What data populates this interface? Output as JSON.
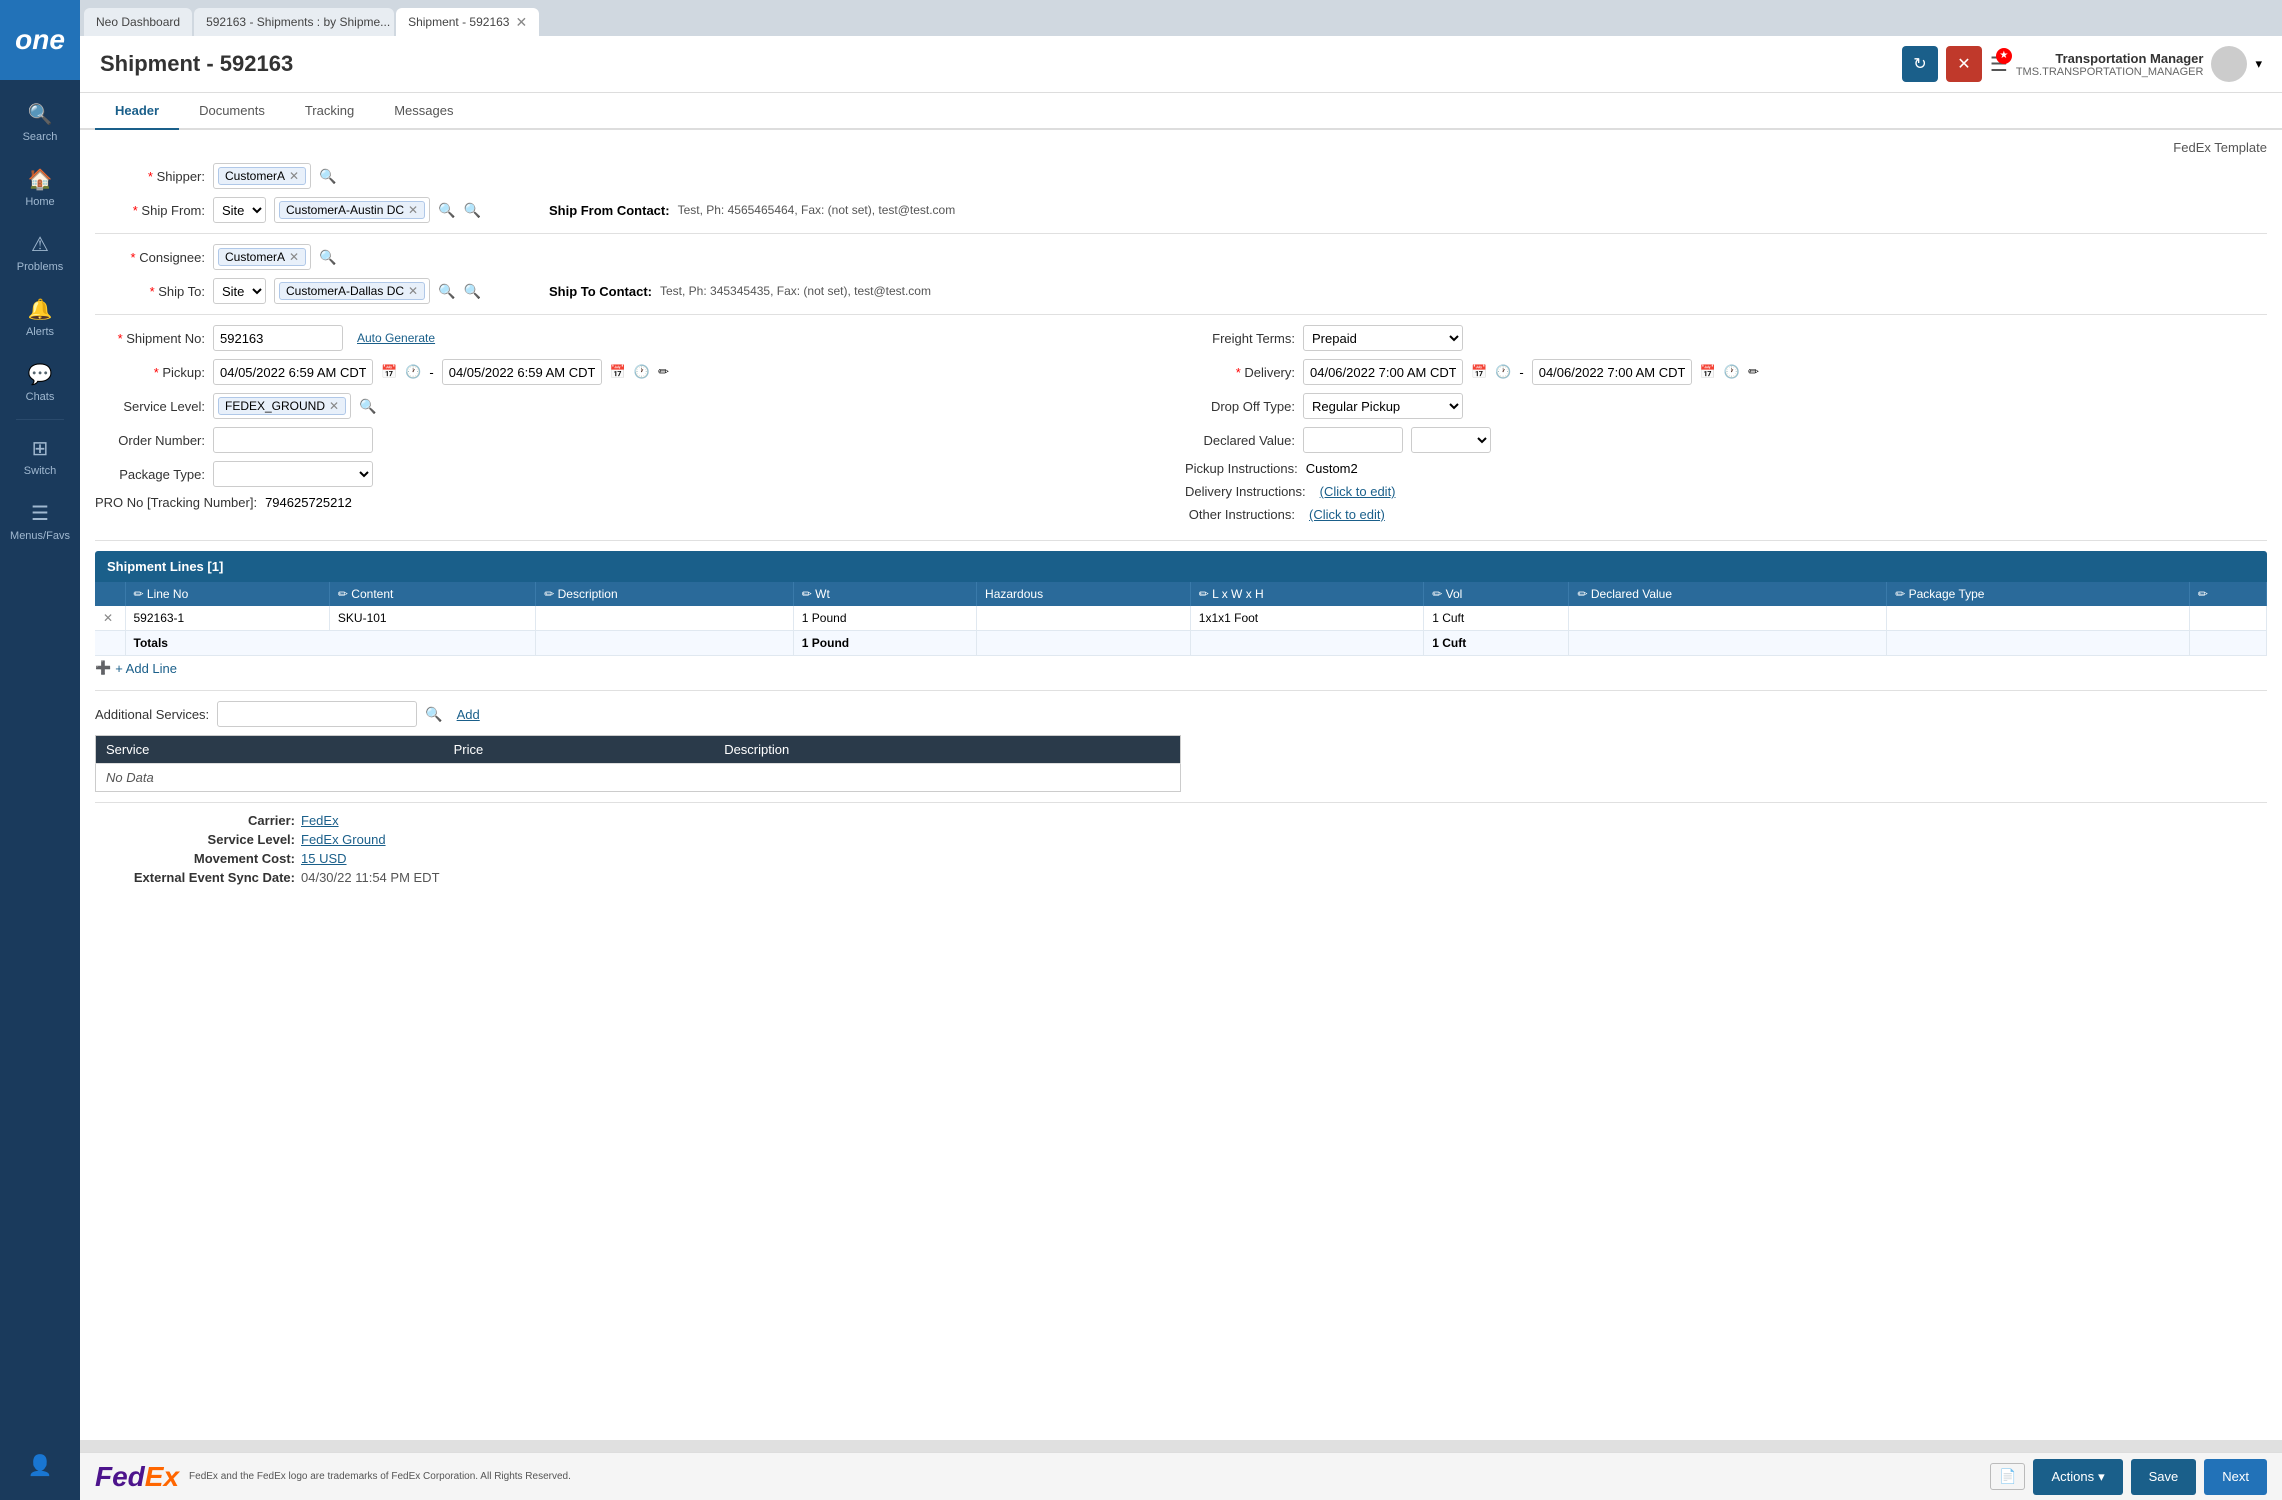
{
  "app": {
    "logo": "one",
    "title": "Shipment - 592163"
  },
  "sidebar": {
    "items": [
      {
        "label": "Search",
        "icon": "🔍"
      },
      {
        "label": "Home",
        "icon": "🏠"
      },
      {
        "label": "Problems",
        "icon": "⚠"
      },
      {
        "label": "Alerts",
        "icon": "🔔"
      },
      {
        "label": "Chats",
        "icon": "💬"
      },
      {
        "label": "Switch",
        "icon": "⊞"
      },
      {
        "label": "Menus/Favs",
        "icon": "☰"
      }
    ]
  },
  "browser_tabs": [
    {
      "label": "Neo Dashboard",
      "active": false,
      "closeable": false
    },
    {
      "label": "592163 - Shipments : by Shipme...",
      "active": false,
      "closeable": true
    },
    {
      "label": "Shipment - 592163",
      "active": true,
      "closeable": true
    }
  ],
  "header": {
    "title": "Shipment - 592163",
    "user_name": "Transportation Manager",
    "user_role": "TMS.TRANSPORTATION_MANAGER"
  },
  "tabs": [
    {
      "label": "Header",
      "active": true
    },
    {
      "label": "Documents",
      "active": false
    },
    {
      "label": "Tracking",
      "active": false
    },
    {
      "label": "Messages",
      "active": false
    }
  ],
  "fedex_template": "FedEx Template",
  "form": {
    "shipper_label": "Shipper:",
    "shipper_value": "CustomerA",
    "ship_from_label": "Ship From:",
    "ship_from_site": "Site",
    "ship_from_dc": "CustomerA-Austin DC",
    "ship_from_contact_label": "Ship From Contact:",
    "ship_from_contact_value": "Test, Ph: 4565465464, Fax: (not set), test@test.com",
    "consignee_label": "Consignee:",
    "consignee_value": "CustomerA",
    "ship_to_label": "Ship To:",
    "ship_to_site": "Site",
    "ship_to_dc": "CustomerA-Dallas DC",
    "ship_to_contact_label": "Ship To Contact:",
    "ship_to_contact_value": "Test, Ph: 345345435, Fax: (not set), test@test.com",
    "shipment_no_label": "Shipment No:",
    "shipment_no_value": "592163",
    "auto_generate": "Auto Generate",
    "freight_terms_label": "Freight Terms:",
    "freight_terms_value": "Prepaid",
    "pickup_label": "Pickup:",
    "pickup_date1": "04/05/2022 6:59 AM CDT",
    "pickup_date2": "04/05/2022 6:59 AM CDT",
    "delivery_label": "Delivery:",
    "delivery_date1": "04/06/2022 7:00 AM CDT",
    "delivery_date2": "04/06/2022 7:00 AM CDT",
    "service_level_label": "Service Level:",
    "service_level_value": "FEDEX_GROUND",
    "drop_off_type_label": "Drop Off Type:",
    "drop_off_type_value": "Regular Pickup",
    "order_number_label": "Order Number:",
    "order_number_value": "",
    "declared_value_label": "Declared Value:",
    "declared_value_value": "",
    "package_type_label": "Package Type:",
    "package_type_value": "",
    "pickup_instructions_label": "Pickup Instructions:",
    "pickup_instructions_value": "Custom2",
    "pro_no_label": "PRO No [Tracking Number]:",
    "pro_no_value": "794625725212",
    "delivery_instructions_label": "Delivery Instructions:",
    "delivery_instructions_value": "(Click to edit)",
    "other_instructions_label": "Other Instructions:",
    "other_instructions_value": "(Click to edit)"
  },
  "shipment_lines": {
    "title": "Shipment Lines [1]",
    "columns": [
      "Line No",
      "Content",
      "Description",
      "Wt",
      "Hazardous",
      "L x W x H",
      "Vol",
      "Declared Value",
      "Package Type"
    ],
    "rows": [
      {
        "line_no": "592163-1",
        "content": "SKU-101",
        "description": "",
        "wt": "1 Pound",
        "hazardous": "",
        "lwh": "1x1x1 Foot",
        "vol": "1 Cuft",
        "declared_value": "",
        "package_type": ""
      }
    ],
    "totals": {
      "label": "Totals",
      "wt": "1 Pound",
      "vol": "1 Cuft"
    },
    "add_line": "+ Add Line"
  },
  "additional_services": {
    "label": "Additional Services:",
    "add_btn": "Add",
    "columns": [
      "Service",
      "Price",
      "Description"
    ],
    "no_data": "No Data"
  },
  "carrier_info": {
    "carrier_label": "Carrier:",
    "carrier_value": "FedEx",
    "service_level_label": "Service Level:",
    "service_level_value": "FedEx Ground",
    "movement_cost_label": "Movement Cost:",
    "movement_cost_value": "15 USD",
    "event_sync_label": "External Event Sync Date:",
    "event_sync_value": "04/30/22 11:54 PM EDT"
  },
  "bottom_bar": {
    "fedex_disclaimer": "FedEx and the FedEx logo are trademarks of FedEx Corporation. All Rights Reserved.",
    "actions_btn": "Actions",
    "save_btn": "Save",
    "next_btn": "Next"
  }
}
